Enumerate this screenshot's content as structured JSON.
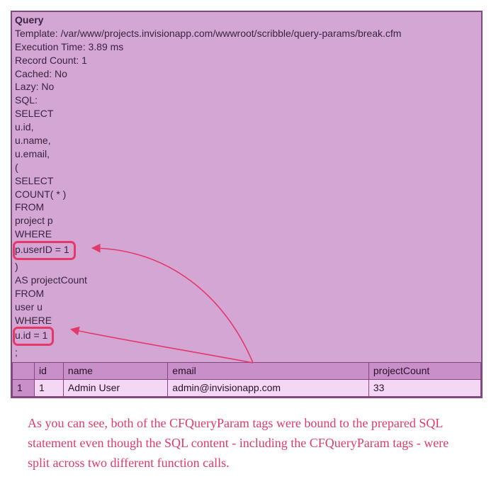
{
  "debug": {
    "title": "Query",
    "template_label": "Template:",
    "template_value": "/var/www/projects.invisionapp.com/wwwroot/scribble/query-params/break.cfm",
    "exec_label": "Execution Time:",
    "exec_value": "3.89 ms",
    "record_label": "Record Count:",
    "record_value": "1",
    "cached_label": "Cached:",
    "cached_value": "No",
    "lazy_label": "Lazy:",
    "lazy_value": "No",
    "sql_label": "SQL:"
  },
  "sql": {
    "l1": "SELECT",
    "l2": "u.id,",
    "l3": "u.name,",
    "l4": "u.email,",
    "l5": "(",
    "l6": "SELECT",
    "l7": "COUNT( * )",
    "l8": "FROM",
    "l9": "project p",
    "l10": "WHERE",
    "l11_hi": "p.userID = 1",
    "l12": ")",
    "l13": "AS projectCount",
    "l14": "FROM",
    "l15": "user u",
    "l16": "WHERE",
    "l17_hi": "u.id = 1",
    "l18": ";"
  },
  "table": {
    "headers": {
      "c1": "id",
      "c2": "name",
      "c3": "email",
      "c4": "projectCount"
    },
    "row": {
      "num": "1",
      "c1": "1",
      "c2": "Admin User",
      "c3": "admin@invisionapp.com",
      "c4": "33"
    }
  },
  "note": "As you can see, both of the CFQueryParam tags were bound to the prepared SQL statement even though the SQL content - including the CFQueryParam tags - were split across two different function calls.",
  "colors": {
    "accent": "#e2396a",
    "panel": "#d4a6d4",
    "border": "#804a80"
  }
}
